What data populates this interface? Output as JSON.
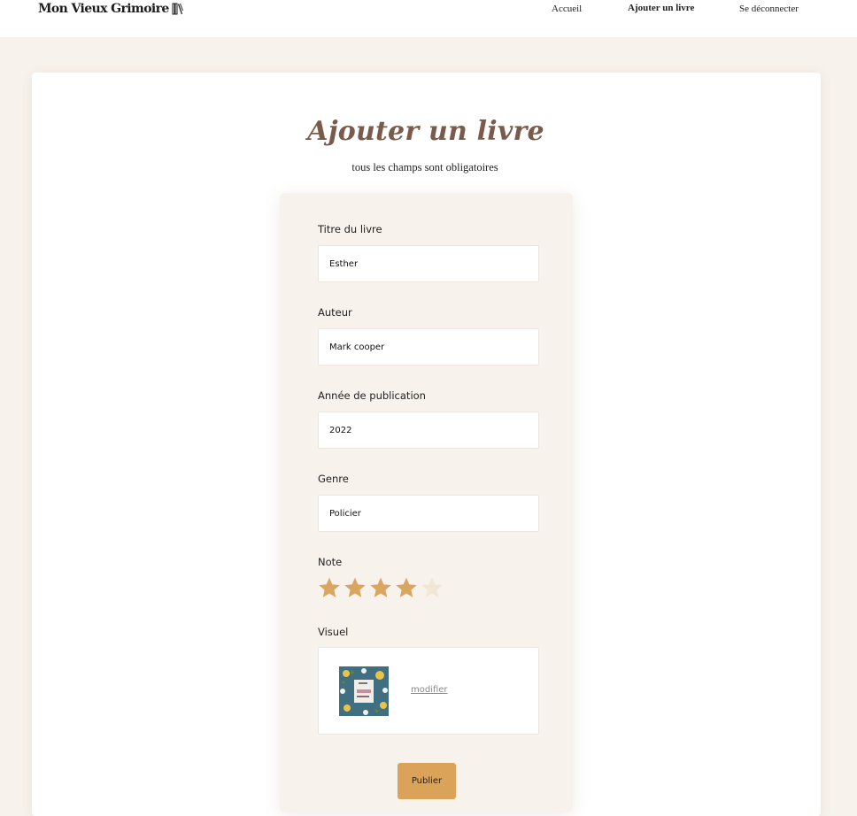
{
  "header": {
    "logo_text": "Mon Vieux Grimoire",
    "logo_icon": "books-icon",
    "nav": {
      "home": "Accueil",
      "add_book": "Ajouter un livre",
      "logout": "Se déconnecter"
    }
  },
  "page": {
    "title": "Ajouter un livre",
    "subtitle": "tous les champs sont obligatoires"
  },
  "form": {
    "title_label": "Titre du livre",
    "title_value": "Esther",
    "author_label": "Auteur",
    "author_value": "Mark cooper",
    "year_label": "Année de publication",
    "year_value": "2022",
    "genre_label": "Genre",
    "genre_value": "Policier",
    "rating_label": "Note",
    "rating_value": 4,
    "rating_max": 5,
    "visual_label": "Visuel",
    "modify_label": "modifier",
    "publish_label": "Publier"
  },
  "colors": {
    "accent": "#dba35a",
    "star_filled": "#d9a662",
    "star_empty": "#f2e6d4",
    "title_color": "#7a5a4a",
    "background": "#f7f2eb"
  }
}
